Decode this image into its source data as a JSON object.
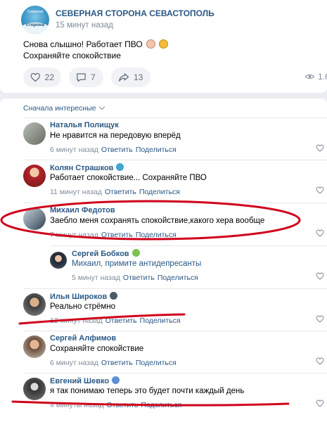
{
  "post": {
    "group_name": "СЕВЕРНАЯ СТОРОНА СЕВАСТОПОЛЬ",
    "group_avatar_top": "Северная",
    "group_avatar_word": "сторона",
    "time": "15 минут назад",
    "text_line1": "Снова слышно! Работает ПВО",
    "text_line2": "Сохраняйте спокойствие",
    "likes": "22",
    "comments": "7",
    "shares": "13",
    "views": "1.6"
  },
  "comments_section": {
    "sort_label": "Сначала интересные",
    "comments": [
      {
        "name": "Наталья Полищук",
        "text": "Не нравится на передовую вперёд",
        "time": "6 минут назад",
        "reply": "Ответить",
        "share": "Поделиться"
      },
      {
        "name": "Колян Страшков",
        "text": "Работает спокойствие... Сохраняйте ПВО",
        "time": "11 минут назад",
        "reply": "Ответить",
        "share": "Поделиться"
      },
      {
        "name": "Михаил Федотов",
        "text": "Заебло меня сохранять спокойствие,какого хера вообще",
        "time": "7 минут назад",
        "reply": "Ответить",
        "share": "Поделиться"
      },
      {
        "name": "Сергей Бобков",
        "text": "Михаил, примите антидепресанты",
        "time": "5 минут назад",
        "reply": "Ответить",
        "share": "Поделиться"
      },
      {
        "name": "Илья Широков",
        "text": "Реально стрёмно",
        "time": "12 минут назад",
        "reply": "Ответить",
        "share": "Поделиться"
      },
      {
        "name": "Сергей Алфимов",
        "text": "Сохраняйте спокойствие",
        "time": "6 минут назад",
        "reply": "Ответить",
        "share": "Поделиться"
      },
      {
        "name": "Евгений Шевко",
        "text": "я так понимаю теперь это будет почти каждый день",
        "time": "4 минуты назад",
        "reply": "Ответить",
        "share": "Поделиться"
      }
    ]
  },
  "colors": {
    "link": "#2a5885",
    "meta": "#818c99",
    "annotation": "#d0021b",
    "background": "#ebedf0"
  },
  "icons": [
    "heart-icon",
    "comment-icon",
    "share-icon",
    "eye-icon",
    "chevron-down-icon"
  ]
}
